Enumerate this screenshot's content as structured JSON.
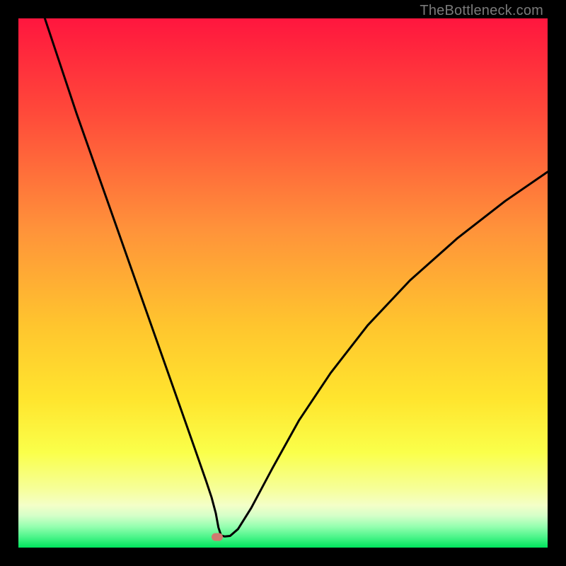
{
  "watermark": "TheBottleneck.com",
  "marker": {
    "x_pct": 37.5,
    "y_pct": 98.0
  },
  "colors": {
    "top": "#ff163e",
    "mid1": "#ff7a3a",
    "mid2": "#ffd22e",
    "mid3": "#f9ff4a",
    "mid4": "#f4ffb2",
    "bottom_band": "#7cffa4",
    "bottom": "#00e45c",
    "curve": "#000000",
    "marker": "#cf7a6f"
  },
  "chart_data": {
    "type": "line",
    "title": "",
    "xlabel": "",
    "ylabel": "",
    "xlim": [
      0,
      100
    ],
    "ylim": [
      0,
      100
    ],
    "series": [
      {
        "name": "bottleneck-curve",
        "x": [
          5,
          8,
          11,
          14,
          17,
          20,
          23,
          26,
          29,
          32,
          34,
          35.5,
          36.5,
          37.3,
          37.8,
          38.3,
          39,
          40,
          41.5,
          44,
          48,
          53,
          59,
          66,
          74,
          83,
          92,
          100
        ],
        "y": [
          100,
          91,
          82,
          73.5,
          65,
          56.5,
          48,
          39.5,
          31,
          22.5,
          16.8,
          12.5,
          9.5,
          6.5,
          3.8,
          2.3,
          2.1,
          2.2,
          3.5,
          7.5,
          15,
          24,
          33,
          42,
          50.5,
          58.5,
          65.5,
          71
        ]
      }
    ],
    "annotations": []
  }
}
